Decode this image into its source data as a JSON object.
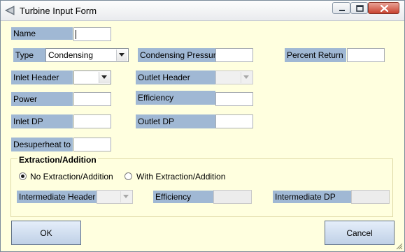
{
  "window": {
    "title": "Turbine Input Form",
    "minimize_label": "Minimize",
    "maximize_label": "Maximize",
    "close_label": "Close"
  },
  "form": {
    "name_label": "Name",
    "name_value": "",
    "type_label": "Type",
    "type_value": "Condensing",
    "condensing_pressure_label": "Condensing Pressure",
    "condensing_pressure_value": "",
    "percent_return_label": "Percent Return",
    "percent_return_value": "",
    "inlet_header_label": "Inlet Header",
    "inlet_header_value": "",
    "outlet_header_label": "Outlet Header",
    "outlet_header_value": "",
    "power_label": "Power",
    "power_value": "",
    "efficiency_label": "Efficiency",
    "efficiency_value": "",
    "inlet_dp_label": "Inlet DP",
    "inlet_dp_value": "",
    "outlet_dp_label": "Outlet DP",
    "outlet_dp_value": "",
    "desuperheat_label": "Desuperheat to",
    "desuperheat_value": ""
  },
  "extraction": {
    "group_title": "Extraction/Addition",
    "option_none": "No Extraction/Addition",
    "option_with": "With Extraction/Addition",
    "selected": "none",
    "intermediate_header_label": "Intermediate Header",
    "intermediate_header_value": "",
    "efficiency_label": "Efficiency",
    "efficiency_value": "",
    "intermediate_dp_label": "Intermediate DP",
    "intermediate_dp_value": ""
  },
  "buttons": {
    "ok": "OK",
    "cancel": "Cancel"
  },
  "colors": {
    "window_background": "#ffffdf",
    "label_background": "#a0b8d4",
    "close_button": "#c94330"
  }
}
